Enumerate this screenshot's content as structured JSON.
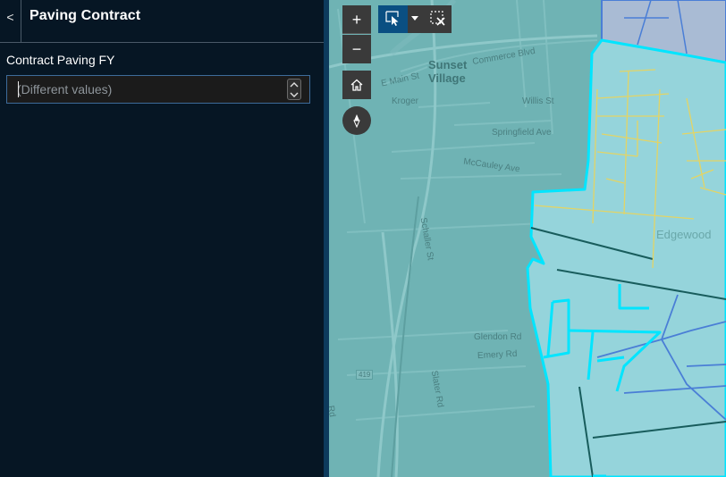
{
  "panel": {
    "back_glyph": "<",
    "title": "Paving Contract",
    "field_label": "Contract Paving FY",
    "field_placeholder": "(Different values)"
  },
  "map": {
    "labels": {
      "sunset_village": "Sunset\nVillage",
      "main_st": "E Main St",
      "commerce_blvd": "Commerce Blvd",
      "kroger": "Kroger",
      "willis_st": "Willis St",
      "springfield_ave": "Springfield Ave",
      "mccauley_ave": "McCauley Ave",
      "schaller_st": "Schaller St",
      "edgewood": "Edgewood",
      "glendon_rd": "Glendon Rd",
      "emory_rd": "Emery Rd",
      "route_419": "419",
      "slater_rd": "Slater Rd",
      "side_rd": "Rd"
    },
    "controls": {
      "zoom_in": "+",
      "zoom_out": "−",
      "home_icon": "home-icon",
      "compass_icon": "compass-icon",
      "select_icon": "select-pointer-icon",
      "clear_icon": "clear-selection-icon"
    },
    "colors": {
      "base": "#6fb3b4",
      "highlight_fill": "#95d4db",
      "highlight_outline": "#00e5ff",
      "paving_line": "#e3d465",
      "road_dark": "#185c5c",
      "road_blue": "#4a7ed6",
      "neighbor_fill": "#a9bbd4"
    }
  }
}
